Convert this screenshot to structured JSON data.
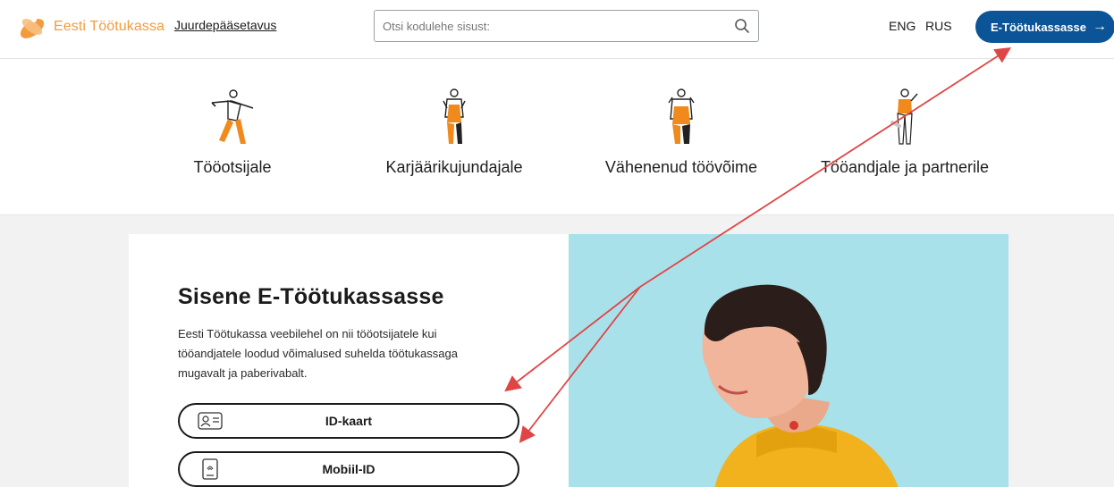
{
  "header": {
    "logo_text": "Eesti Töötukassa",
    "accessibility_link": "Juurdepääsetavus",
    "search_placeholder": "Otsi kodulehe sisust:",
    "lang_eng": "ENG",
    "lang_rus": "RUS",
    "eportal_button": "E-Töötukassasse",
    "eportal_arrow": "→"
  },
  "audience": {
    "items": [
      {
        "label": "Tööotsijale"
      },
      {
        "label": "Karjäärikujundajale"
      },
      {
        "label": "Vähenenud töövõime"
      },
      {
        "label": "Tööandjale ja partnerile"
      }
    ]
  },
  "login": {
    "title": "Sisene E-Töötukassasse",
    "description": "Eesti Töötukassa veebilehel on nii tööotsijatele kui tööandjatele loodud võimalused suhelda töötukassaga mugavalt ja paberivabalt.",
    "idcard_button": "ID-kaart",
    "mobile_button": "Mobiil-ID"
  },
  "colors": {
    "brand_orange": "#f29b3e",
    "primary_blue": "#0b5497",
    "hero_background": "#a8e1ea",
    "annotation_red": "#e04545"
  },
  "icons": [
    "logo-icon",
    "search-icon",
    "arrow-right-icon",
    "id-card-icon",
    "fingerprint-phone-icon"
  ]
}
